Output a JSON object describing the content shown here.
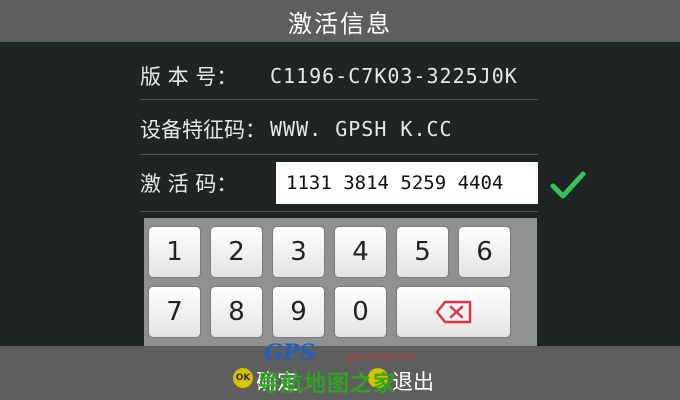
{
  "header": {
    "title": "激活信息"
  },
  "info": {
    "version_label": "版 本 号：",
    "version_value": "C1196-C7K03-3225J0K",
    "device_code_label": "设备特征码：",
    "device_code_value": "WWW. GPSH K.CC",
    "activation_label": "激 活 码：",
    "activation_value": "1131 3814 5259 4404"
  },
  "keypad": {
    "row1": [
      "1",
      "2",
      "3",
      "4",
      "5",
      "6"
    ],
    "row2": [
      "7",
      "8",
      "9",
      "0"
    ]
  },
  "footer": {
    "ok_icon_text": "OK",
    "ok_label": "确定",
    "exit_label": "退出"
  },
  "watermark": {
    "logo": "GPS",
    "url": "gpsonroad.com",
    "text": "导航地图之家"
  },
  "colors": {
    "background": "#1f2424",
    "bar": "#5e5e5e",
    "check": "#35c45a",
    "delete": "#d9344a"
  },
  "icons": {
    "check": "check-icon",
    "delete": "backspace-icon",
    "ok": "ok-icon",
    "back": "back-icon"
  }
}
